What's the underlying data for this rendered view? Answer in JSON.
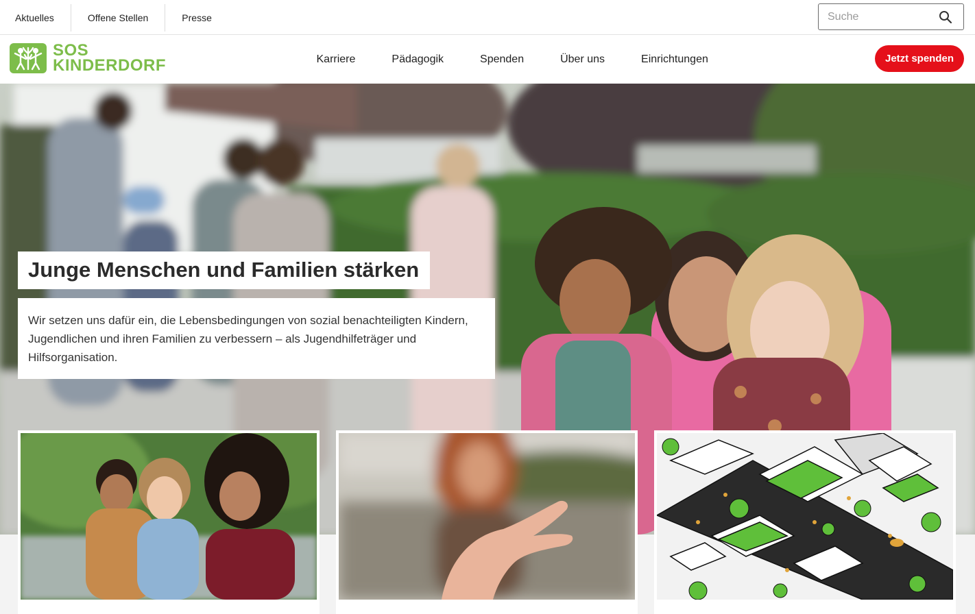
{
  "utility": {
    "links": [
      "Aktuelles",
      "Offene Stellen",
      "Presse"
    ],
    "search_placeholder": "Suche",
    "search_icon": "search-icon"
  },
  "nav": {
    "logo_line1": "SOS",
    "logo_line2": "KINDERDORF",
    "items": [
      "Karriere",
      "Pädagogik",
      "Spenden",
      "Über uns",
      "Einrichtungen"
    ],
    "donate_label": "Jetzt spenden"
  },
  "hero": {
    "title": "Junge Menschen und Familien stärken",
    "text": "Wir setzen uns dafür ein, die Lebensbedingungen von sozial benachteiligten Kindern, Jugendlichen und ihren Familien zu verbessern – als Jugendhilfeträger und Hilfsorganisation."
  },
  "colors": {
    "brand_green": "#7dbd4a",
    "donate_red": "#e5101a"
  }
}
